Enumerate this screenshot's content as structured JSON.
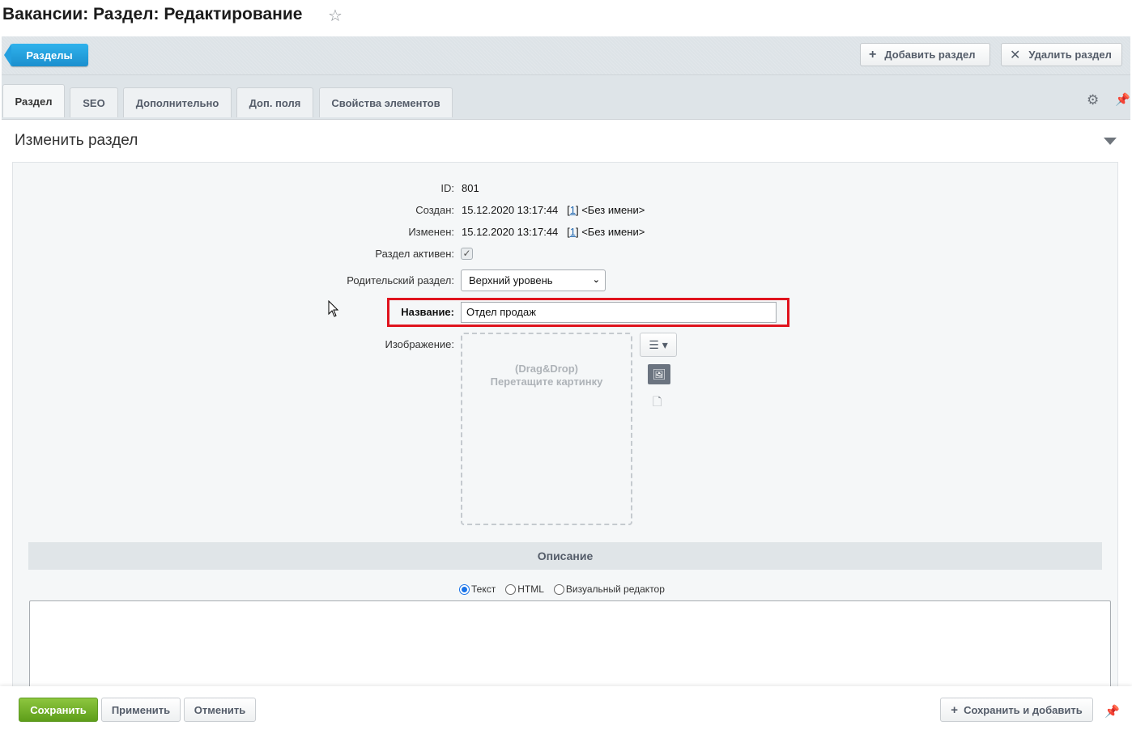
{
  "page": {
    "title": "Вакансии: Раздел: Редактирование"
  },
  "toolbar": {
    "sections_label": "Разделы",
    "add_section_label": "Добавить раздел",
    "delete_section_label": "Удалить раздел"
  },
  "tabs": [
    {
      "label": "Раздел",
      "active": true
    },
    {
      "label": "SEO"
    },
    {
      "label": "Дополнительно"
    },
    {
      "label": "Доп. поля"
    },
    {
      "label": "Свойства элементов"
    }
  ],
  "section": {
    "title": "Изменить раздел"
  },
  "form": {
    "id_label": "ID:",
    "id_value": "801",
    "created_label": "Создан:",
    "created_value": "15.12.2020 13:17:44",
    "created_user_link": "1",
    "created_user_name": "<Без имени>",
    "modified_label": "Изменен:",
    "modified_value": "15.12.2020 13:17:44",
    "modified_user_link": "1",
    "modified_user_name": "<Без имени>",
    "active_label": "Раздел активен:",
    "active_checked": true,
    "parent_label": "Родительский раздел:",
    "parent_value": "Верхний уровень",
    "name_label": "Название:",
    "name_value": "Отдел продаж",
    "image_label": "Изображение:",
    "dropzone_line1": "(Drag&Drop)",
    "dropzone_line2": "Перетащите картинку"
  },
  "description": {
    "header": "Описание",
    "modes": [
      "Текст",
      "HTML",
      "Визуальный редактор"
    ],
    "selected_mode": "Текст"
  },
  "footer": {
    "save_label": "Сохранить",
    "apply_label": "Применить",
    "cancel_label": "Отменить",
    "save_add_label": "Сохранить и добавить"
  },
  "colors": {
    "accent_blue": "#1b8fce",
    "save_green": "#6aa82a",
    "highlight_red": "#e0141e"
  }
}
